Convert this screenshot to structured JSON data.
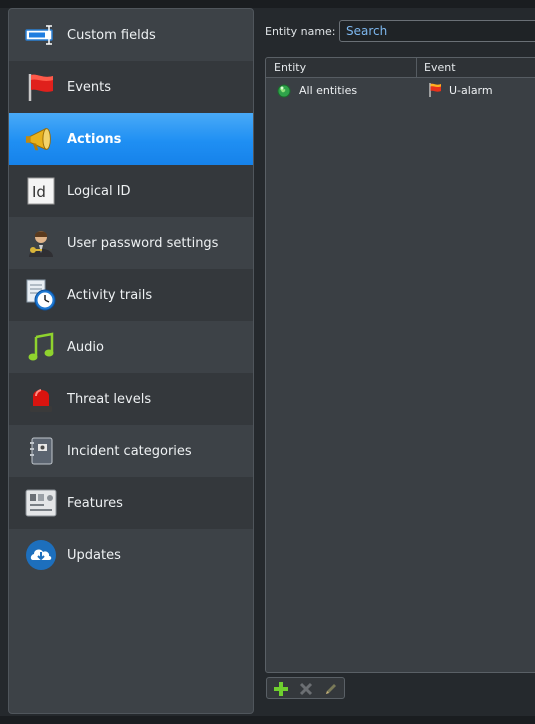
{
  "sidebar": {
    "items": [
      {
        "label": "Custom fields",
        "icon": "custom-fields-icon"
      },
      {
        "label": "Events",
        "icon": "red-flag-icon"
      },
      {
        "label": "Actions",
        "icon": "megaphone-icon",
        "selected": true
      },
      {
        "label": "Logical ID",
        "icon": "logical-id-icon"
      },
      {
        "label": "User password settings",
        "icon": "user-key-icon"
      },
      {
        "label": "Activity trails",
        "icon": "activity-clock-icon"
      },
      {
        "label": "Audio",
        "icon": "music-note-icon"
      },
      {
        "label": "Threat levels",
        "icon": "siren-icon"
      },
      {
        "label": "Incident categories",
        "icon": "notebook-icon"
      },
      {
        "label": "Features",
        "icon": "features-panel-icon"
      },
      {
        "label": "Updates",
        "icon": "cloud-download-icon"
      }
    ]
  },
  "filter": {
    "label": "Entity name:",
    "placeholder": "Search",
    "value": ""
  },
  "table": {
    "columns": [
      "Entity",
      "Event"
    ],
    "rows": [
      {
        "entity": "All entities",
        "entity_icon": "green-globe-icon",
        "event": "U-alarm",
        "event_icon": "red-flag-icon"
      }
    ]
  },
  "toolbar": {
    "buttons": [
      "add-icon",
      "delete-icon",
      "edit-icon"
    ]
  },
  "colors": {
    "selected": "#1f8ff3",
    "search_text": "#8fc7ff",
    "add_green": "#6fcf2f"
  }
}
